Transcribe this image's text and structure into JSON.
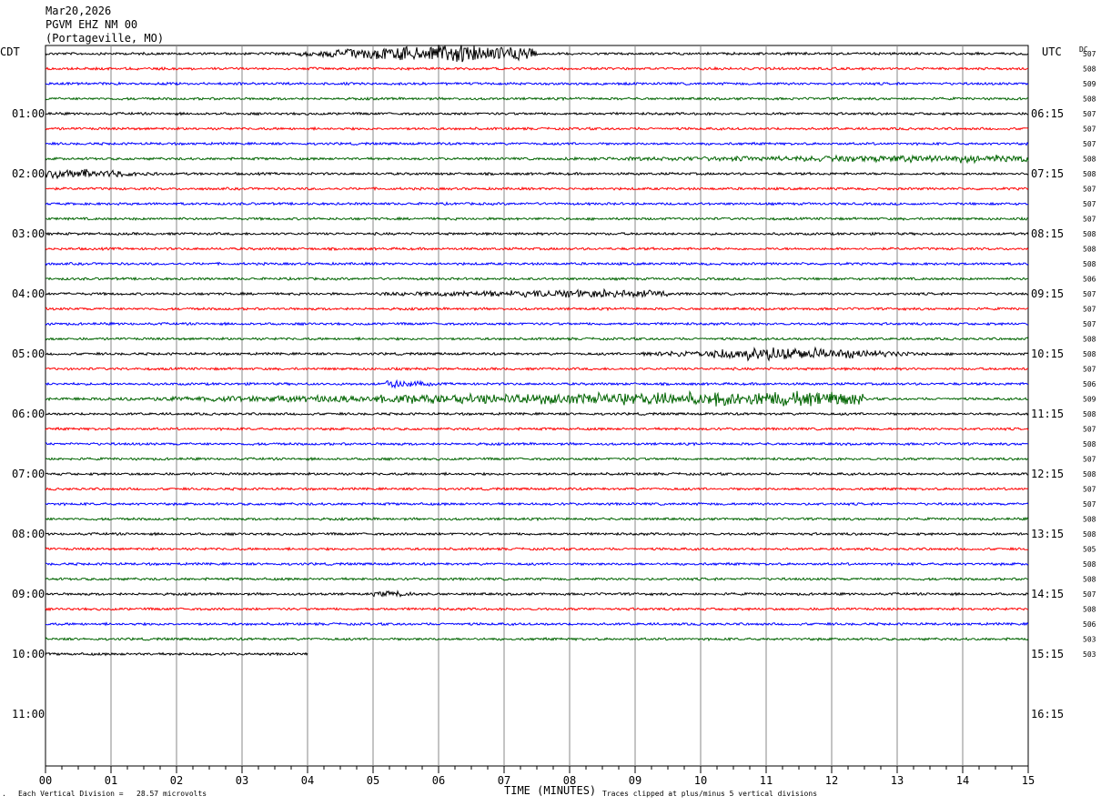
{
  "header": {
    "date": "Mar20,2026",
    "station": "PGVM EHZ NM 00",
    "location": "(Portageville, MO)",
    "left_zone": "CDT",
    "right_zone": "UTC",
    "dc_label": "DC"
  },
  "footer": {
    "corner_mark": "·",
    "division_note": "Each Vertical Division =   28.57 microvolts",
    "x_title": "TIME (MINUTES)",
    "clip_note": "Traces clipped at plus/minus 5 vertical divisions"
  },
  "chart_data": {
    "type": "line",
    "title": "PGVM EHZ NM 00",
    "xlabel": "TIME (MINUTES)",
    "ylabel": "",
    "xlim": [
      0,
      15
    ],
    "x_ticks": [
      "00",
      "01",
      "02",
      "03",
      "04",
      "05",
      "06",
      "07",
      "08",
      "09",
      "10",
      "11",
      "12",
      "13",
      "14",
      "15"
    ],
    "grid": true,
    "colors": [
      "#000000",
      "#ff0000",
      "#0000ff",
      "#006400"
    ],
    "hour_labels_left": [
      "01:00",
      "02:00",
      "03:00",
      "04:00",
      "05:00",
      "06:00",
      "07:00",
      "08:00",
      "09:00",
      "10:00",
      "11:00"
    ],
    "hour_labels_right": [
      "06:15",
      "07:15",
      "08:15",
      "09:15",
      "10:15",
      "11:15",
      "12:15",
      "13:15",
      "14:15",
      "15:15",
      "16:15"
    ],
    "dc_offsets": [
      "507",
      "508",
      "509",
      "508",
      "507",
      "507",
      "507",
      "508",
      "508",
      "507",
      "507",
      "507",
      "508",
      "508",
      "508",
      "506",
      "507",
      "507",
      "507",
      "508",
      "508",
      "507",
      "506",
      "509",
      "508",
      "507",
      "508",
      "507",
      "508",
      "507",
      "507",
      "508",
      "508",
      "505",
      "508",
      "508",
      "507",
      "508",
      "506",
      "503",
      "503"
    ],
    "trace_count": 41,
    "last_trace_end_minute": 4.0,
    "events": [
      {
        "trace": 0,
        "start": 3.5,
        "end": 7.5,
        "peak_amplitude": 5,
        "center": 6.2
      },
      {
        "trace": 7,
        "start": 7.5,
        "end": 15,
        "peak_amplitude": 1.6,
        "center": 14.0
      },
      {
        "trace": 8,
        "start": 0,
        "end": 1.8,
        "peak_amplitude": 2.4,
        "center": 0.4
      },
      {
        "trace": 16,
        "start": 4.5,
        "end": 9.5,
        "peak_amplitude": 1.8,
        "center": 8.5
      },
      {
        "trace": 20,
        "start": 9.0,
        "end": 13.5,
        "peak_amplitude": 3.5,
        "center": 11.2
      },
      {
        "trace": 22,
        "start": 5.2,
        "end": 6.0,
        "peak_amplitude": 2.2,
        "center": 5.3
      },
      {
        "trace": 23,
        "start": 0,
        "end": 12.5,
        "peak_amplitude": 3.6,
        "center": 11.0
      },
      {
        "trace": 36,
        "start": 5.0,
        "end": 5.8,
        "peak_amplitude": 1.2,
        "center": 5.3
      }
    ]
  }
}
